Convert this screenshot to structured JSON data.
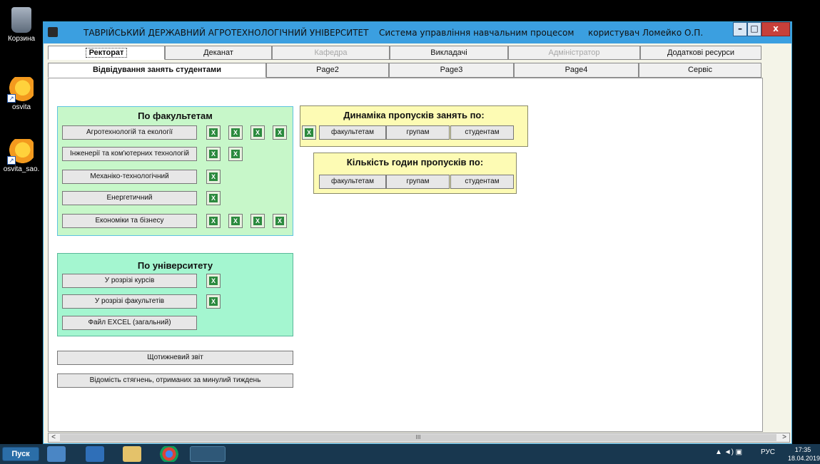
{
  "desktop": {
    "icons": [
      {
        "label": "Корзина"
      },
      {
        "label": "osvita"
      },
      {
        "label": "osvita_sao."
      }
    ]
  },
  "window": {
    "title": "ТАВРІЙСЬКИЙ ДЕРЖАВНИЙ АГРОТЕХНОЛОГІЧНИЙ УНІВЕРСИТЕТ",
    "subtitle": "Система управління навчальним процесом",
    "user": "користувач Ломейко О.П.",
    "controls": {
      "minimize": "–",
      "maximize": "□",
      "close": "x"
    }
  },
  "main_tabs": [
    {
      "label": "Ректорат",
      "state": "active"
    },
    {
      "label": "Деканат",
      "state": "normal"
    },
    {
      "label": "Кафедра",
      "state": "disabled"
    },
    {
      "label": "Викладачі",
      "state": "normal"
    },
    {
      "label": "Адміністратор",
      "state": "disabled"
    },
    {
      "label": "Додаткові ресурси",
      "state": "normal"
    }
  ],
  "sub_tabs": [
    {
      "label": "Відвідування занять студентами",
      "state": "active"
    },
    {
      "label": "Page2"
    },
    {
      "label": "Page3"
    },
    {
      "label": "Page4"
    },
    {
      "label": "Сервіс"
    }
  ],
  "faculties_panel": {
    "title": "По факультетам",
    "rows": [
      {
        "label": "Агротехнологій та екології",
        "excel_count": 4
      },
      {
        "label": "Інженерії та ком'ютерних технологій",
        "excel_count": 2
      },
      {
        "label": "Механіко-технологічний",
        "excel_count": 1
      },
      {
        "label": "Енергетичний",
        "excel_count": 1
      },
      {
        "label": "Економіки та бізнесу",
        "excel_count": 4
      }
    ]
  },
  "university_panel": {
    "title": "По університету",
    "rows": [
      {
        "label": "У розрізі курсів"
      },
      {
        "label": "У розрізі факультетів"
      },
      {
        "label": "Файл EXCEL (загальний)"
      }
    ]
  },
  "dynamics_panel": {
    "title": "Динаміка пропусків занять по:",
    "buttons": [
      "факультетам",
      "групам",
      "студентам"
    ]
  },
  "hours_panel": {
    "title": "Кількість годин пропусків  по:",
    "buttons": [
      "факультетам",
      "групам",
      "студентам"
    ]
  },
  "reports": {
    "weekly": "Щотижневий звіт",
    "debts": "Відомість стягнень, отриманих за минулий тиждень"
  },
  "scrollbar": {
    "left": "<",
    "right": ">",
    "grip": "III"
  },
  "taskbar": {
    "start": "Пуск",
    "language": "РУС",
    "time": "17:35",
    "date": "18.04.2019"
  },
  "colors": {
    "title_bar": "#3b9fe0",
    "faculties_bg": "#c7f7c9",
    "university_bg": "#a4f6d0",
    "yellow_bg": "#fdfbb4"
  }
}
